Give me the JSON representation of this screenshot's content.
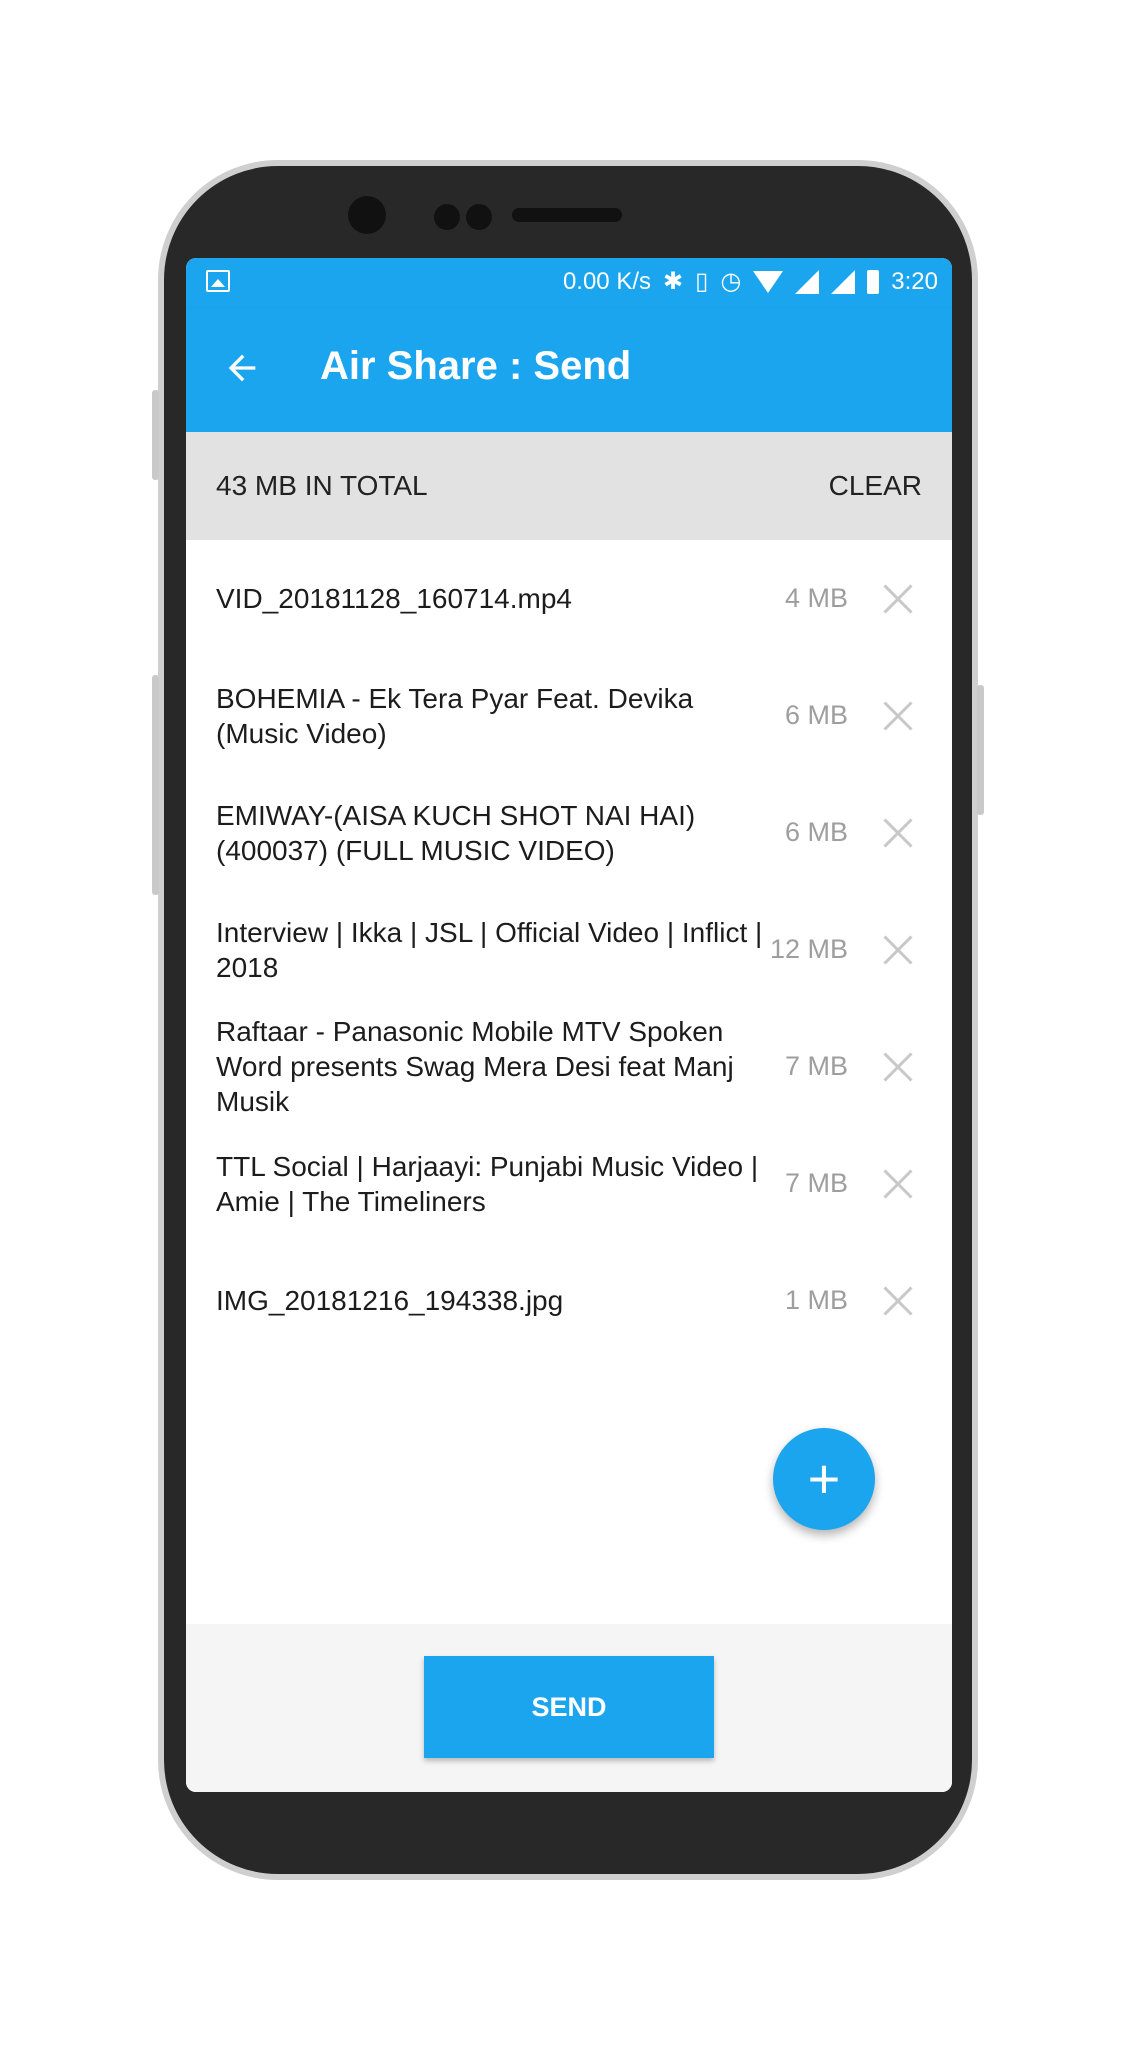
{
  "status_bar": {
    "net_speed": "0.00 K/s",
    "time": "3:20",
    "icons": [
      "image-icon",
      "bluetooth-icon",
      "vibrate-icon",
      "alarm-icon",
      "wifi-icon",
      "signal-r-icon",
      "signal-icon",
      "battery-icon"
    ]
  },
  "app_bar": {
    "title": "Air Share : Send",
    "back_icon": "arrow-left-icon",
    "color": "#1ba5ee"
  },
  "summary": {
    "total": "43 MB IN TOTAL",
    "clear_label": "CLEAR"
  },
  "files": [
    {
      "name": "VID_20181128_160714.mp4",
      "size": "4 MB"
    },
    {
      "name": "BOHEMIA - Ek Tera Pyar Feat. Devika  (Music Video)",
      "size": "6 MB"
    },
    {
      "name": "EMIWAY-(AISA KUCH SHOT NAI HAI) (400037) (FULL MUSIC VIDEO)",
      "size": "6 MB"
    },
    {
      "name": "Interview | Ikka | JSL |  Official Video | Inflict | 2018",
      "size": "12 MB"
    },
    {
      "name": "Raftaar - Panasonic Mobile MTV Spoken Word presents Swag Mera Desi feat Manj Musik",
      "size": "7 MB"
    },
    {
      "name": "TTL Social | Harjaayi: Punjabi Music Video | Amie | The Timeliners",
      "size": "7 MB"
    },
    {
      "name": "IMG_20181216_194338.jpg",
      "size": "1 MB"
    }
  ],
  "fab": {
    "icon": "plus-icon",
    "label": "+"
  },
  "send_button": {
    "label": "SEND"
  }
}
